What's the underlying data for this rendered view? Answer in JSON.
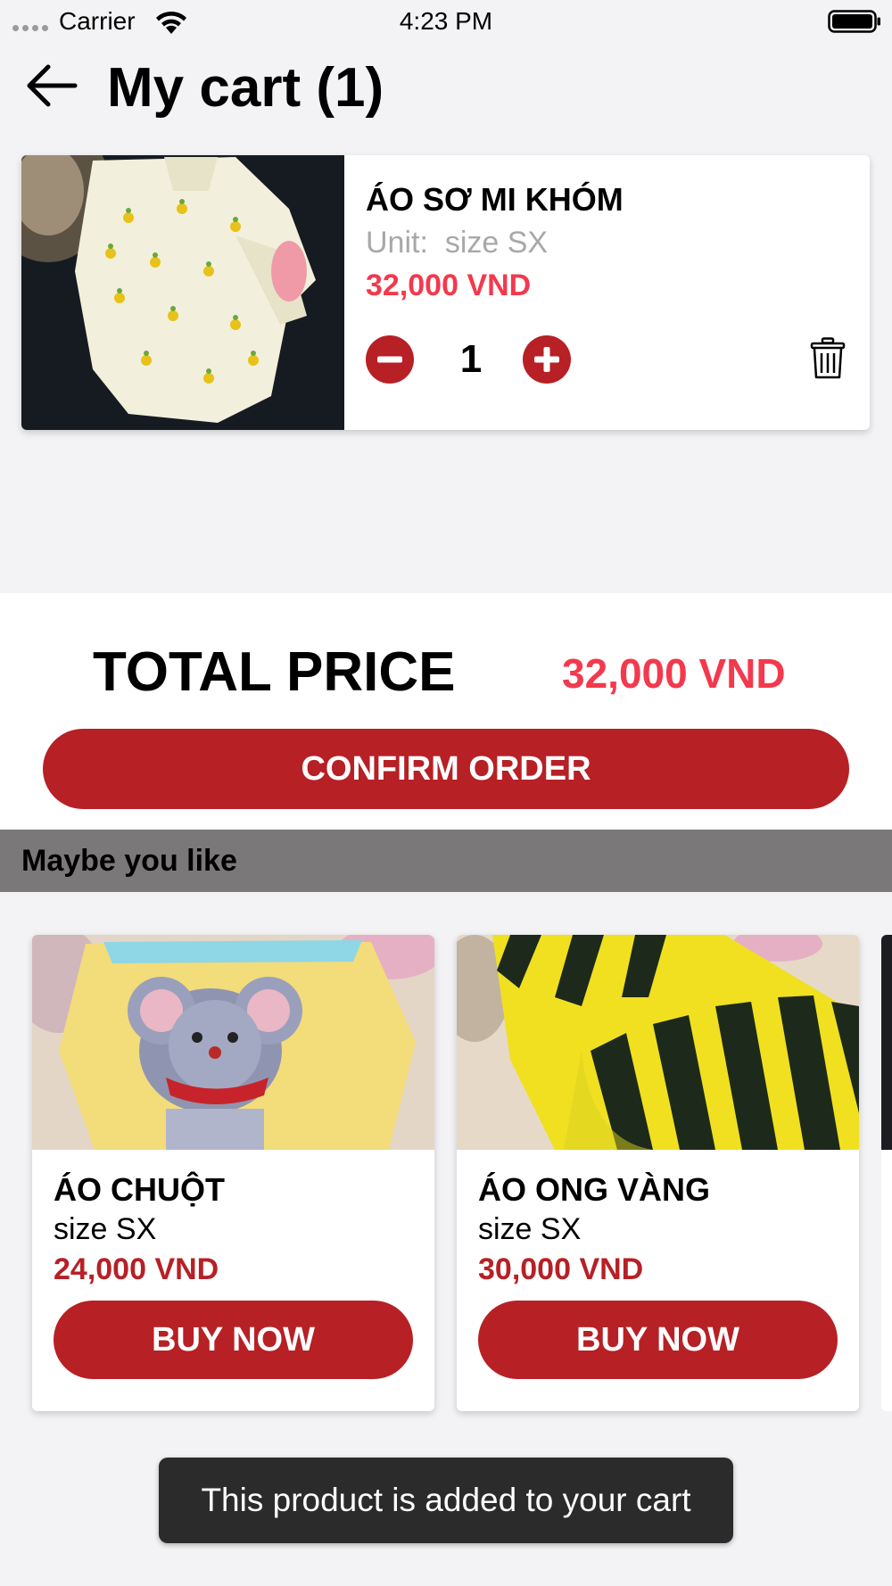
{
  "status_bar": {
    "carrier": "Carrier",
    "time": "4:23 PM"
  },
  "header": {
    "title": "My cart (1)",
    "back_icon": "arrow-left-icon"
  },
  "cart": {
    "items": [
      {
        "name": "ÁO SƠ MI KHÓM",
        "unit_label": "Unit:",
        "unit_value": "size SX",
        "price": "32,000 VND",
        "quantity": "1",
        "image_desc": "cream shirt with pineapple print"
      }
    ]
  },
  "total": {
    "label": "TOTAL PRICE",
    "value": "32,000 VND",
    "confirm_label": "CONFIRM ORDER"
  },
  "suggestions": {
    "title": "Maybe you like",
    "products": [
      {
        "name": "ÁO CHUỘT",
        "unit": "size SX",
        "price": "24,000 VND",
        "buy_label": "BUY NOW"
      },
      {
        "name": "ÁO ONG VÀNG",
        "unit": "size SX",
        "price": "30,000 VND",
        "buy_label": "BUY NOW"
      }
    ]
  },
  "toast": {
    "message": "This product is added to your cart"
  },
  "colors": {
    "accent_red": "#b72025",
    "price_red": "#f3394d",
    "background": "#f3f3f5",
    "section_header": "#7a7878",
    "toast_bg": "#2b2b2b"
  }
}
